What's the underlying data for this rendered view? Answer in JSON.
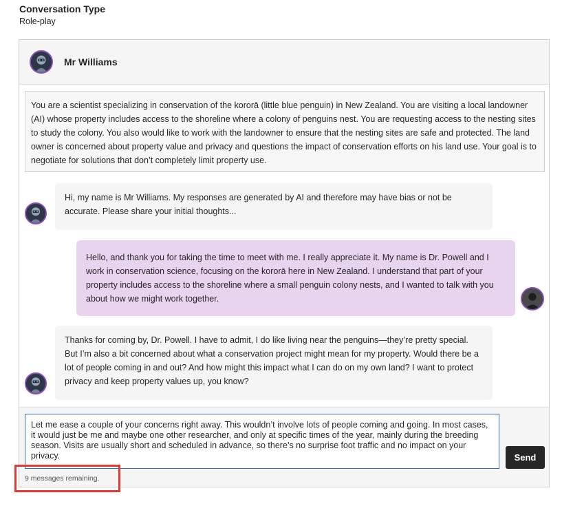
{
  "conversation_type": {
    "label": "Conversation Type",
    "value": "Role-play"
  },
  "persona": {
    "name": "Mr Williams",
    "avatar_icon": "robot-avatar-icon"
  },
  "scenario": "You are a scientist specializing in conservation of the kororā (little blue penguin) in New Zealand. You are visiting a local landowner (AI) whose property includes access to the shoreline where a colony of penguins nest. You are requesting access to the nesting sites to study the colony. You also would like to work with the landowner to ensure that the nesting sites are safe and protected. The land owner is concerned about property value and privacy and questions the impact of conservation efforts on his land use. Your goal is to negotiate for solutions that don’t completely limit property use.",
  "messages": [
    {
      "role": "ai",
      "text": "Hi, my name is Mr Williams. My responses are generated by AI and therefore may have bias or not be accurate. Please share your initial thoughts..."
    },
    {
      "role": "user",
      "text": "Hello, and thank you for taking the time to meet with me. I really appreciate it. My name is Dr. Powell and I work in conservation science, focusing on the kororā here in New Zealand. I understand that part of your property includes access to the shoreline where a small penguin colony nests, and I wanted to talk with you about how we might work together."
    },
    {
      "role": "ai",
      "text": "Thanks for coming by, Dr. Powell. I have to admit, I do like living near the penguins—they’re pretty special. But I’m also a bit concerned about what a conservation project might mean for my property. Would there be a lot of people coming in and out? And how might this impact what I can do on my own land? I want to protect privacy and keep property values up, you know?"
    }
  ],
  "composer": {
    "draft": "Let me ease a couple of your concerns right away. This wouldn’t involve lots of people coming and going. In most cases, it would just be me and maybe one other researcher, and only at specific times of the year, mainly during the breeding season. Visits are usually short and scheduled in advance, so there’s no surprise foot traffic and no impact on your privacy.",
    "send_label": "Send",
    "remaining": "9 messages remaining."
  },
  "colors": {
    "accent_purple": "#8a4fb8",
    "user_bubble": "#e9d4ef",
    "highlight": "#e53935"
  }
}
